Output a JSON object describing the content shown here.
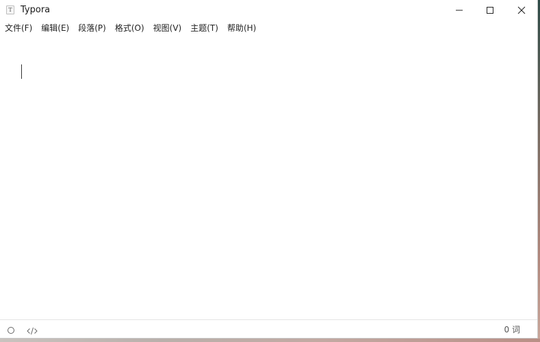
{
  "window": {
    "title": "Typora",
    "icon_letter": "T",
    "controls": {
      "minimize": "minimize-icon",
      "maximize": "maximize-icon",
      "close": "close-icon"
    }
  },
  "menu": {
    "items": [
      {
        "label": "文件(F)",
        "name": "menu-file"
      },
      {
        "label": "编辑(E)",
        "name": "menu-edit"
      },
      {
        "label": "段落(P)",
        "name": "menu-paragraph"
      },
      {
        "label": "格式(O)",
        "name": "menu-format"
      },
      {
        "label": "视图(V)",
        "name": "menu-view"
      },
      {
        "label": "主题(T)",
        "name": "menu-theme"
      },
      {
        "label": "帮助(H)",
        "name": "menu-help"
      }
    ]
  },
  "editor": {
    "content": ""
  },
  "statusbar": {
    "outline_icon": "circle-icon",
    "source_icon": "code-icon",
    "word_count": "0 词"
  }
}
